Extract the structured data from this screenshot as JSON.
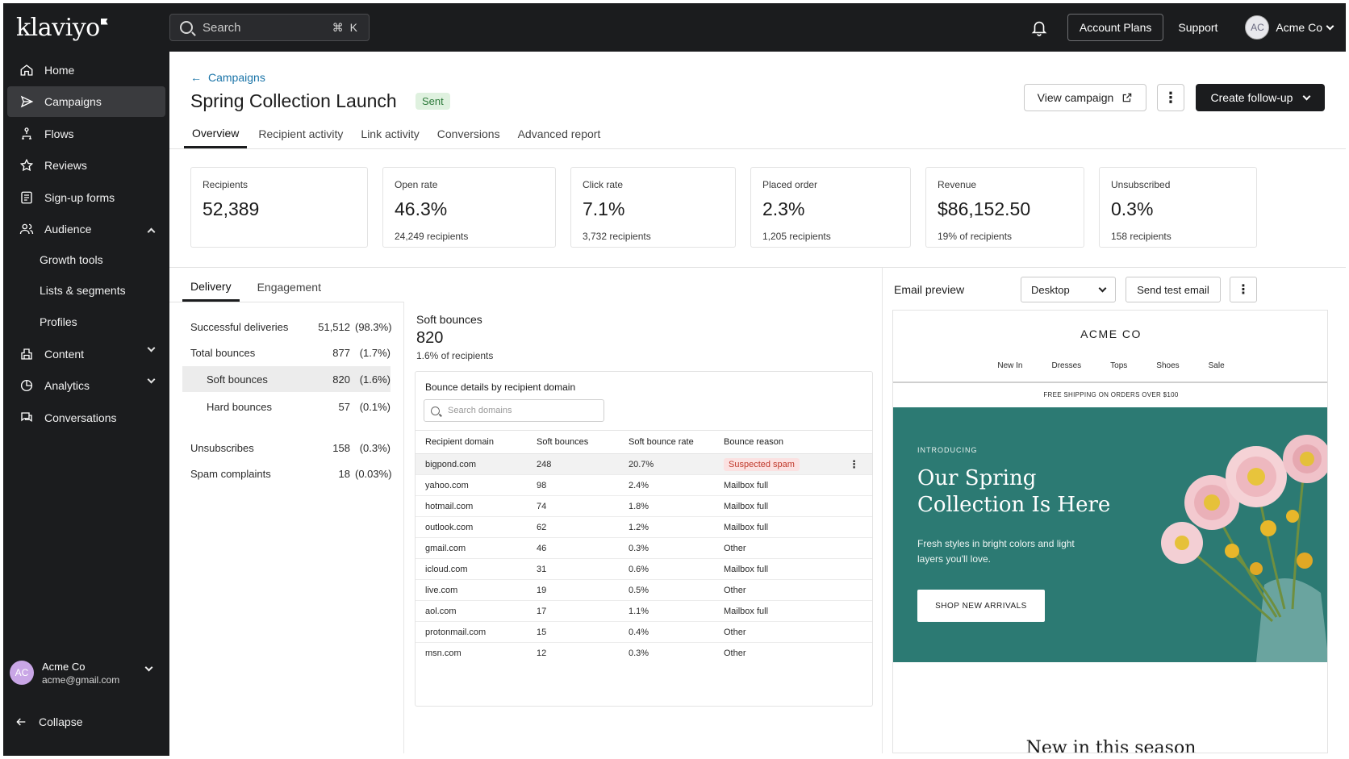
{
  "topbar": {
    "logo": "klaviyo",
    "search_placeholder": "Search",
    "search_shortcut": "⌘ K",
    "account_plans": "Account Plans",
    "support": "Support",
    "avatar_initials": "AC",
    "user_name": "Acme Co"
  },
  "sidebar": {
    "items": [
      {
        "label": "Home",
        "icon": "home-icon"
      },
      {
        "label": "Campaigns",
        "icon": "send-icon"
      },
      {
        "label": "Flows",
        "icon": "flows-icon"
      },
      {
        "label": "Reviews",
        "icon": "star-icon"
      },
      {
        "label": "Sign-up forms",
        "icon": "form-icon"
      },
      {
        "label": "Audience",
        "icon": "audience-icon"
      },
      {
        "label": "Content",
        "icon": "content-icon"
      },
      {
        "label": "Analytics",
        "icon": "analytics-icon"
      },
      {
        "label": "Conversations",
        "icon": "chat-icon"
      }
    ],
    "audience_sub": [
      "Growth tools",
      "Lists & segments",
      "Profiles"
    ],
    "user": {
      "initials": "AC",
      "name": "Acme Co",
      "email": "acme@gmail.com"
    },
    "collapse": "Collapse"
  },
  "header": {
    "breadcrumb": "Campaigns",
    "title": "Spring Collection Launch",
    "status": "Sent",
    "view_campaign": "View campaign",
    "create_followup": "Create follow-up"
  },
  "tabs": [
    "Overview",
    "Recipient activity",
    "Link activity",
    "Conversions",
    "Advanced report"
  ],
  "metrics": [
    {
      "label": "Recipients",
      "value": "52,389",
      "sub": ""
    },
    {
      "label": "Open rate",
      "value": "46.3%",
      "sub": "24,249 recipients"
    },
    {
      "label": "Click rate",
      "value": "7.1%",
      "sub": "3,732 recipients"
    },
    {
      "label": "Placed order",
      "value": "2.3%",
      "sub": "1,205 recipients"
    },
    {
      "label": "Revenue",
      "value": "$86,152.50",
      "sub": "19% of recipients"
    },
    {
      "label": "Unsubscribed",
      "value": "0.3%",
      "sub": "158 recipients"
    }
  ],
  "delivery": {
    "tabs": [
      "Delivery",
      "Engagement"
    ],
    "rows": [
      {
        "name": "Successful deliveries",
        "value": "51,512",
        "pct": "(98.3%)"
      },
      {
        "name": "Total bounces",
        "value": "877",
        "pct": "(1.7%)"
      },
      {
        "name": "Soft bounces",
        "value": "820",
        "pct": "(1.6%)"
      },
      {
        "name": "Hard bounces",
        "value": "57",
        "pct": "(0.1%)"
      },
      {
        "name": "Unsubscribes",
        "value": "158",
        "pct": "(0.3%)"
      },
      {
        "name": "Spam complaints",
        "value": "18",
        "pct": "(0.03%)"
      }
    ]
  },
  "soft_bounces": {
    "title": "Soft bounces",
    "value": "820",
    "sub": "1.6% of recipients",
    "card_title": "Bounce details by recipient domain",
    "search_placeholder": "Search domains",
    "columns": [
      "Recipient domain",
      "Soft bounces",
      "Soft bounce rate",
      "Bounce reason"
    ],
    "rows": [
      {
        "domain": "bigpond.com",
        "count": "248",
        "rate": "20.7%",
        "reason": "Suspected spam"
      },
      {
        "domain": "yahoo.com",
        "count": "98",
        "rate": "2.4%",
        "reason": "Mailbox full"
      },
      {
        "domain": "hotmail.com",
        "count": "74",
        "rate": "1.8%",
        "reason": "Mailbox full"
      },
      {
        "domain": "outlook.com",
        "count": "62",
        "rate": "1.2%",
        "reason": "Mailbox full"
      },
      {
        "domain": "gmail.com",
        "count": "46",
        "rate": "0.3%",
        "reason": "Other"
      },
      {
        "domain": "icloud.com",
        "count": "31",
        "rate": "0.6%",
        "reason": "Mailbox full"
      },
      {
        "domain": "live.com",
        "count": "19",
        "rate": "0.5%",
        "reason": "Other"
      },
      {
        "domain": "aol.com",
        "count": "17",
        "rate": "1.1%",
        "reason": "Mailbox full"
      },
      {
        "domain": "protonmail.com",
        "count": "15",
        "rate": "0.4%",
        "reason": "Other"
      },
      {
        "domain": "msn.com",
        "count": "12",
        "rate": "0.3%",
        "reason": "Other"
      }
    ]
  },
  "email_preview": {
    "title": "Email preview",
    "device": "Desktop",
    "send_test": "Send test email",
    "brand": "ACME CO",
    "nav": [
      "New In",
      "Dresses",
      "Tops",
      "Shoes",
      "Sale"
    ],
    "shipping": "FREE SHIPPING ON ORDERS OVER $100",
    "intro": "INTRODUCING",
    "headline": "Our Spring Collection Is Here",
    "copy": "Fresh styles in bright colors and light layers you'll love.",
    "cta": "SHOP NEW ARRIVALS",
    "footer_heading": "New in this season"
  },
  "colors": {
    "dark": "#1b1c1e",
    "accent_link": "#1a74a8",
    "sent_badge": "#dff1df",
    "hero_teal": "#2c7a73",
    "spam_badge": "#fbe1e1"
  }
}
